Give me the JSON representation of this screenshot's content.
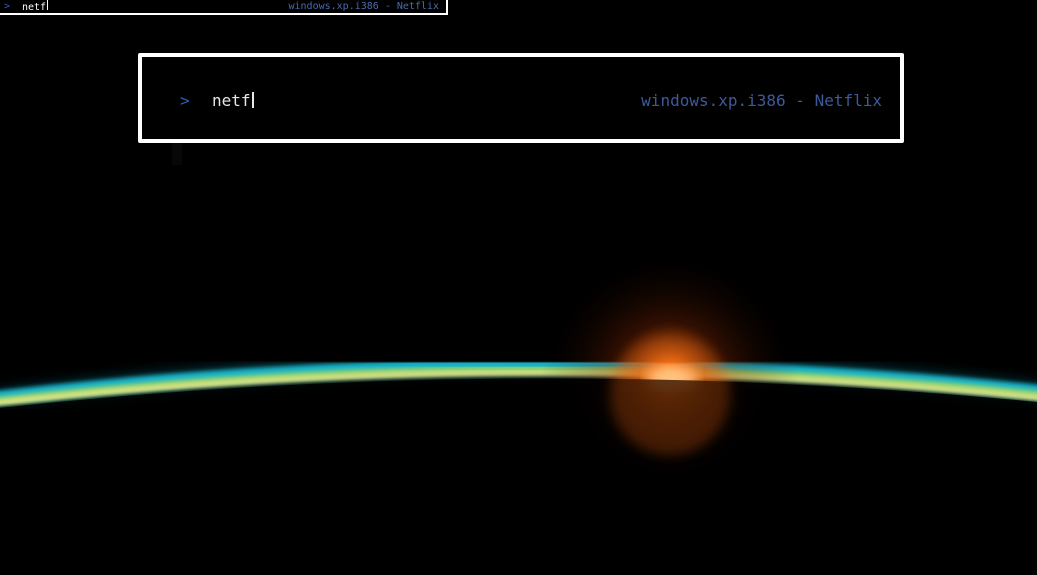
{
  "wallpaper": {
    "scene": "earth-horizon-sunrise",
    "colors": {
      "atmosphere_inner": "#f6e98a",
      "atmosphere_green": "#9ad46c",
      "atmosphere_outer": "#19b2c8",
      "sun": "#ff7a1a",
      "space": "#000000"
    }
  },
  "mini_launcher": {
    "prompt_icon": "chevron-right-icon",
    "prompt_glyph": ">",
    "query": "netf",
    "result": "windows.xp.i386 - Netflix"
  },
  "launcher": {
    "prompt_icon": "chevron-right-icon",
    "prompt_glyph": ">",
    "query": "netf",
    "result": "windows.xp.i386 - Netflix",
    "accent_color": "#2e5fb8",
    "result_color": "#3c5a9a",
    "border_color": "#ffffff"
  }
}
